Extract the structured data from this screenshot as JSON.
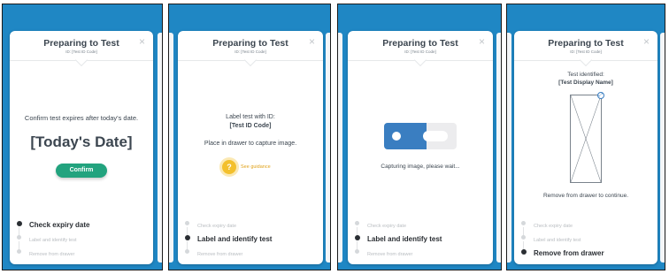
{
  "colors": {
    "frame_background": "#1f87c4",
    "confirm_green": "#22a37e",
    "guidance_yellow": "#f3c02d",
    "capture_blue": "#3a7ec1"
  },
  "screens": [
    {
      "title": "Preparing to Test",
      "subtitle": "ID: [Test ID Code]",
      "close_icon": "×",
      "text": "Confirm test expires after today's date.",
      "date": "[Today's Date]",
      "confirm_label": "Confirm",
      "steps": [
        {
          "label": "Check expiry date",
          "active": true
        },
        {
          "label": "Label and identify test",
          "active": false
        },
        {
          "label": "Remove from drawer",
          "active": false
        }
      ]
    },
    {
      "title": "Preparing to Test",
      "subtitle": "ID: [Test ID Code]",
      "close_icon": "×",
      "line1": "Label test with ID:",
      "line2": "[Test ID Code]",
      "line3": "Place in drawer to capture image.",
      "guidance_icon": "?",
      "guidance_label": "See guidance",
      "steps": [
        {
          "label": "Check expiry date",
          "active": false
        },
        {
          "label": "Label and identify test",
          "active": true
        },
        {
          "label": "Remove from drawer",
          "active": false
        }
      ]
    },
    {
      "title": "Preparing to Test",
      "subtitle": "ID: [Test ID Code]",
      "close_icon": "×",
      "text": "Capturing image, please wait...",
      "steps": [
        {
          "label": "Check expiry date",
          "active": false
        },
        {
          "label": "Label and identify test",
          "active": true
        },
        {
          "label": "Remove from drawer",
          "active": false
        }
      ]
    },
    {
      "title": "Preparing to Test",
      "subtitle": "ID: [Test ID Code]",
      "close_icon": "×",
      "line1": "Test identified:",
      "line2": "[Test Display Name]",
      "expand_icon": "expand-icon",
      "text": "Remove from drawer to continue.",
      "steps": [
        {
          "label": "Check expiry date",
          "active": false
        },
        {
          "label": "Label and identify test",
          "active": false
        },
        {
          "label": "Remove from drawer",
          "active": true
        }
      ]
    }
  ]
}
